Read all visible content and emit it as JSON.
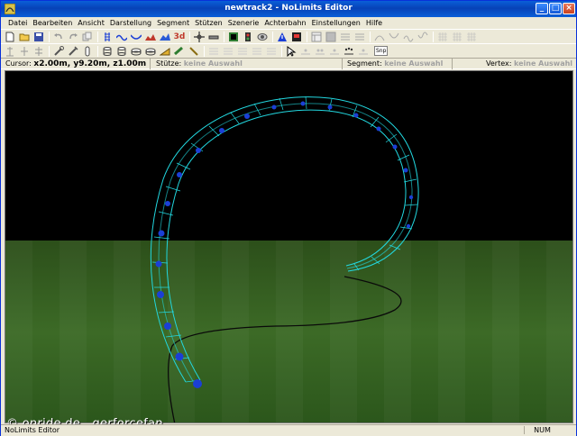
{
  "window": {
    "title": "newtrack2 - NoLimits Editor"
  },
  "menu": [
    "Datei",
    "Bearbeiten",
    "Ansicht",
    "Darstellung",
    "Segment",
    "Stützen",
    "Szenerie",
    "Achterbahn",
    "Einstellungen",
    "Hilfe"
  ],
  "toolbar": {
    "row1_icons": [
      "new-file-icon",
      "open-folder-icon",
      "save-icon",
      "undo-icon",
      "redo-icon",
      "copy-icon",
      "rail-icon",
      "track-wave-icon",
      "track-valley-icon",
      "scenery-icon",
      "terrain-icon",
      "3d-icon",
      "move-icon",
      "minus-icon",
      "render-icon",
      "record-icon",
      "camera-icon",
      "warning-icon",
      "stop-icon",
      "layout-icon"
    ],
    "row2_icons": [
      "support-icon",
      "support-a-icon",
      "support-b-icon",
      "wrench-icon",
      "tool-icon",
      "column-icon",
      "cylinder-icon",
      "cylinder-b-icon",
      "cylinder-c-icon",
      "cylinder-d-icon",
      "ramp-icon",
      "beam-icon",
      "cursor-icon",
      "vertex-icon",
      "split-icon",
      "join-icon",
      "node-icon",
      "node-b-icon",
      "snap-icon"
    ],
    "snap_label": "Snp",
    "threed_label": "3d"
  },
  "info": {
    "cursor_label": "Cursor:",
    "cursor_value": "x2.00m, y9.20m, z1.00m",
    "stuetze_label": "Stütze:",
    "stuetze_value": "keine Auswahl",
    "segment_label": "Segment:",
    "segment_value": "keine Auswahl",
    "vertex_label": "Vertex:",
    "vertex_value": "keine Auswahl"
  },
  "status": {
    "text": "NoLimits Editor",
    "num": "NUM"
  },
  "watermark": "© onride.de . gerforcefan",
  "colors": {
    "track": "#22d8e0",
    "node": "#1b3fd6",
    "sky": "#000000",
    "ground": "#2b5a1c"
  }
}
